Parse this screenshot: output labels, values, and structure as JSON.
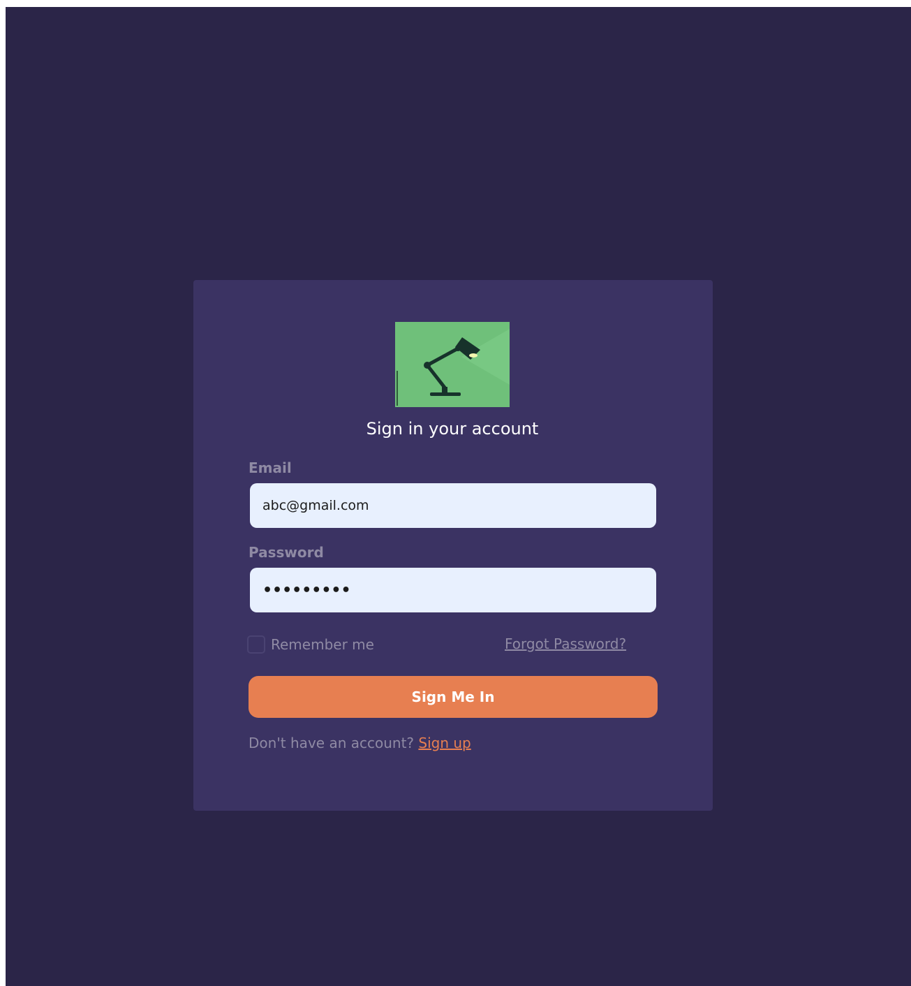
{
  "colors": {
    "page_background": "#2b2548",
    "card_background": "#3b3363",
    "accent": "#e77f51",
    "input_background": "#e8f0fe",
    "logo_background": "#6fc07a",
    "muted_text": "#8f8aa4"
  },
  "logo": {
    "icon": "desk-lamp-icon"
  },
  "form": {
    "title": "Sign in your account",
    "email": {
      "label": "Email",
      "value": "abc@gmail.com"
    },
    "password": {
      "label": "Password",
      "masked_value": "•••••••••"
    },
    "remember_me": {
      "label": "Remember me",
      "checked": false
    },
    "forgot_password_label": "Forgot Password?",
    "submit_label": "Sign Me In",
    "signup_prompt": "Don't have an account?",
    "signup_link_label": "Sign up"
  }
}
